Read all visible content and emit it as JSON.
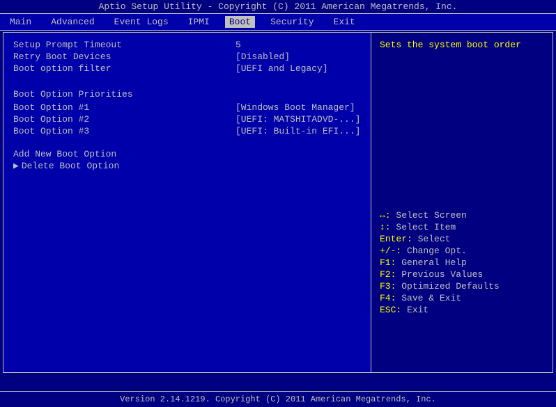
{
  "title_bar": {
    "text": "Aptio Setup Utility - Copyright (C) 2011 American Megatrends, Inc."
  },
  "menu": {
    "items": [
      {
        "label": "Main",
        "active": false
      },
      {
        "label": "Advanced",
        "active": false
      },
      {
        "label": "Event Logs",
        "active": false
      },
      {
        "label": "IPMI",
        "active": false
      },
      {
        "label": "Boot",
        "active": true
      },
      {
        "label": "Security",
        "active": false
      },
      {
        "label": "Exit",
        "active": false
      }
    ]
  },
  "left_panel": {
    "settings": [
      {
        "label": "Setup Prompt Timeout",
        "value": "5"
      },
      {
        "label": "Retry Boot Devices",
        "value": "[Disabled]"
      },
      {
        "label": "Boot option filter",
        "value": "[UEFI and Legacy]"
      }
    ],
    "section_title": "Boot Option Priorities",
    "boot_options": [
      {
        "label": "Boot Option #1",
        "value": "[Windows Boot Manager]"
      },
      {
        "label": "Boot Option #2",
        "value": "[UEFI: MATSHITADVD-...]"
      },
      {
        "label": "Boot Option #3",
        "value": "[UEFI: Built-in EFI...]"
      }
    ],
    "actions": [
      {
        "label": "Add New Boot Option",
        "arrow": false
      },
      {
        "label": "Delete Boot Option",
        "arrow": true
      }
    ]
  },
  "right_panel": {
    "help_text": "Sets the system boot order",
    "keys": [
      {
        "key": "↔:",
        "desc": "Select Screen"
      },
      {
        "key": "↕:",
        "desc": "Select Item"
      },
      {
        "key": "Enter:",
        "desc": "Select"
      },
      {
        "key": "+/-:",
        "desc": "Change Opt."
      },
      {
        "key": "F1:",
        "desc": "General Help"
      },
      {
        "key": "F2:",
        "desc": "Previous Values"
      },
      {
        "key": "F3:",
        "desc": "Optimized Defaults"
      },
      {
        "key": "F4:",
        "desc": "Save & Exit"
      },
      {
        "key": "ESC:",
        "desc": "Exit"
      }
    ]
  },
  "footer": {
    "text": "Version 2.14.1219. Copyright (C) 2011 American Megatrends, Inc."
  }
}
